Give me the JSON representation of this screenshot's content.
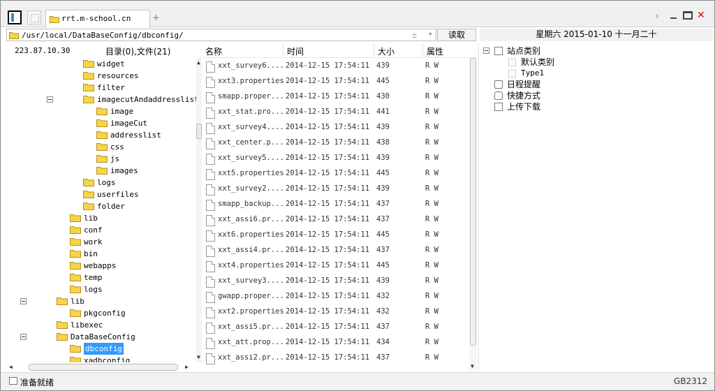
{
  "tab": {
    "title": "rrt.m-school.cn"
  },
  "address": {
    "path": "/usr/local/DataBaseConfig/dbconfig/",
    "read_label": "读取"
  },
  "datebar": {
    "text": "星期六 2015-01-10 十一月二十"
  },
  "left": {
    "ip": "223.87.10.30",
    "count": "目录(0),文件(21)",
    "tree": [
      {
        "label": "widget",
        "indent": 3,
        "expander": false
      },
      {
        "label": "resources",
        "indent": 3,
        "expander": false
      },
      {
        "label": "filter",
        "indent": 3,
        "expander": false
      },
      {
        "label": "imagecutAndaddresslist",
        "indent": 3,
        "expander": true
      },
      {
        "label": "image",
        "indent": 4,
        "expander": false
      },
      {
        "label": "imageCut",
        "indent": 4,
        "expander": false
      },
      {
        "label": "addresslist",
        "indent": 4,
        "expander": false
      },
      {
        "label": "css",
        "indent": 4,
        "expander": false
      },
      {
        "label": "js",
        "indent": 4,
        "expander": false
      },
      {
        "label": "images",
        "indent": 4,
        "expander": false
      },
      {
        "label": "logs",
        "indent": 3,
        "expander": false
      },
      {
        "label": "userfiles",
        "indent": 3,
        "expander": false
      },
      {
        "label": "folder",
        "indent": 3,
        "expander": false
      },
      {
        "label": "lib",
        "indent": 2,
        "expander": false
      },
      {
        "label": "conf",
        "indent": 2,
        "expander": false
      },
      {
        "label": "work",
        "indent": 2,
        "expander": false
      },
      {
        "label": "bin",
        "indent": 2,
        "expander": false
      },
      {
        "label": "webapps",
        "indent": 2,
        "expander": false
      },
      {
        "label": "temp",
        "indent": 2,
        "expander": false
      },
      {
        "label": "logs",
        "indent": 2,
        "expander": false
      },
      {
        "label": "lib",
        "indent": 1,
        "expander": true
      },
      {
        "label": "pkgconfig",
        "indent": 2,
        "expander": false
      },
      {
        "label": "libexec",
        "indent": 1,
        "expander": false
      },
      {
        "label": "DataBaseConfig",
        "indent": 1,
        "expander": true
      },
      {
        "label": "dbconfig",
        "indent": 2,
        "expander": false,
        "selected": true
      },
      {
        "label": "xadbconfig",
        "indent": 2,
        "expander": false
      }
    ]
  },
  "files": {
    "headers": {
      "name": "名称",
      "time": "时间",
      "size": "大小",
      "attr": "属性"
    },
    "rows": [
      {
        "name": "xxt_survey6....",
        "time": "2014-12-15 17:54:11",
        "size": "439",
        "attr": "R W"
      },
      {
        "name": "xxt3.properties",
        "time": "2014-12-15 17:54:11",
        "size": "445",
        "attr": "R W"
      },
      {
        "name": "smapp.proper...",
        "time": "2014-12-15 17:54:11",
        "size": "430",
        "attr": "R W"
      },
      {
        "name": "xxt_stat.pro...",
        "time": "2014-12-15 17:54:11",
        "size": "441",
        "attr": "R W"
      },
      {
        "name": "xxt_survey4....",
        "time": "2014-12-15 17:54:11",
        "size": "439",
        "attr": "R W"
      },
      {
        "name": "xxt_center.p...",
        "time": "2014-12-15 17:54:11",
        "size": "438",
        "attr": "R W"
      },
      {
        "name": "xxt_survey5....",
        "time": "2014-12-15 17:54:11",
        "size": "439",
        "attr": "R W"
      },
      {
        "name": "xxt5.properties",
        "time": "2014-12-15 17:54:11",
        "size": "445",
        "attr": "R W"
      },
      {
        "name": "xxt_survey2....",
        "time": "2014-12-15 17:54:11",
        "size": "439",
        "attr": "R W"
      },
      {
        "name": "smapp_backup...",
        "time": "2014-12-15 17:54:11",
        "size": "437",
        "attr": "R W"
      },
      {
        "name": "xxt_assi6.pr...",
        "time": "2014-12-15 17:54:11",
        "size": "437",
        "attr": "R W"
      },
      {
        "name": "xxt6.properties",
        "time": "2014-12-15 17:54:11",
        "size": "445",
        "attr": "R W"
      },
      {
        "name": "xxt_assi4.pr...",
        "time": "2014-12-15 17:54:11",
        "size": "437",
        "attr": "R W"
      },
      {
        "name": "xxt4.properties",
        "time": "2014-12-15 17:54:11",
        "size": "445",
        "attr": "R W"
      },
      {
        "name": "xxt_survey3....",
        "time": "2014-12-15 17:54:11",
        "size": "439",
        "attr": "R W"
      },
      {
        "name": "gwapp.proper...",
        "time": "2014-12-15 17:54:11",
        "size": "432",
        "attr": "R W"
      },
      {
        "name": "xxt2.properties",
        "time": "2014-12-15 17:54:11",
        "size": "432",
        "attr": "R W"
      },
      {
        "name": "xxt_assi5.pr...",
        "time": "2014-12-15 17:54:11",
        "size": "437",
        "attr": "R W"
      },
      {
        "name": "xxt_att.prop...",
        "time": "2014-12-15 17:54:11",
        "size": "434",
        "attr": "R W"
      },
      {
        "name": "xxt_assi2.pr...",
        "time": "2014-12-15 17:54:11",
        "size": "437",
        "attr": "R W"
      }
    ]
  },
  "right": {
    "site_category": "站点类别",
    "default_category": "默认类别",
    "type1": "Type1",
    "schedule": "日程提醒",
    "shortcut": "快捷方式",
    "upload_download": "上传下载"
  },
  "status": {
    "text": "准备就绪",
    "encoding": "GB2312"
  },
  "colors": {
    "folder": "#f5d54a",
    "selected": "#3399ff",
    "close": "#dd0000"
  },
  "icons": [
    "panel-toggle-icon",
    "blank-tab-icon",
    "folder-icon",
    "plus-icon",
    "chevron-right-icon",
    "minimize-icon",
    "maximize-icon",
    "close-icon",
    "file-icon",
    "collapse-icon",
    "clock-icon",
    "hand-icon",
    "window-icon"
  ]
}
